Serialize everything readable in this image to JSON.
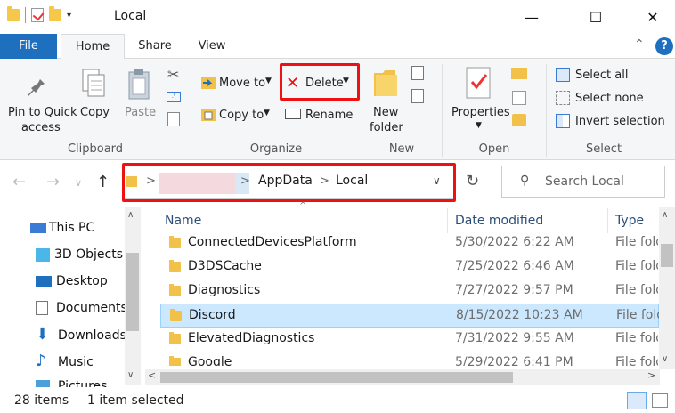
{
  "window": {
    "title": "Local",
    "minimize_glyph": "—",
    "maximize_glyph": "☐",
    "close_glyph": "✕"
  },
  "ribbon_tabs": {
    "file": "File",
    "home": "Home",
    "share": "Share",
    "view": "View"
  },
  "clipboard": {
    "pin": "Pin to Quick",
    "pin2": "access",
    "copy": "Copy",
    "paste": "Paste",
    "label": "Clipboard"
  },
  "organize": {
    "move_to": "Move to",
    "copy_to": "Copy to",
    "delete": "Delete",
    "rename": "Rename",
    "label": "Organize"
  },
  "new_group": {
    "new_folder": "New",
    "new_folder2": "folder",
    "label": "New"
  },
  "open_group": {
    "properties": "Properties",
    "label": "Open"
  },
  "select_group": {
    "select_all": "Select all",
    "select_none": "Select none",
    "invert": "Invert selection",
    "label": "Select"
  },
  "address": {
    "crumb_appdata": "AppData",
    "crumb_local": "Local",
    "sep": ">"
  },
  "search": {
    "placeholder": "Search Local"
  },
  "sidebar": {
    "items": [
      {
        "label": "This PC",
        "icon": "computer-icon"
      },
      {
        "label": "3D Objects",
        "icon": "cube-icon"
      },
      {
        "label": "Desktop",
        "icon": "desktop-icon"
      },
      {
        "label": "Documents",
        "icon": "document-icon"
      },
      {
        "label": "Downloads",
        "icon": "download-icon"
      },
      {
        "label": "Music",
        "icon": "music-icon"
      },
      {
        "label": "Pictures",
        "icon": "picture-icon"
      }
    ]
  },
  "columns": {
    "name": "Name",
    "date": "Date modified",
    "type": "Type"
  },
  "rows": [
    {
      "name": "ConnectedDevicesPlatform",
      "date": "5/30/2022 6:22 AM",
      "type": "File folder",
      "selected": false
    },
    {
      "name": "D3DSCache",
      "date": "7/25/2022 6:46 AM",
      "type": "File folder",
      "selected": false
    },
    {
      "name": "Diagnostics",
      "date": "7/27/2022 9:57 PM",
      "type": "File folder",
      "selected": false
    },
    {
      "name": "Discord",
      "date": "8/15/2022 10:23 AM",
      "type": "File folder",
      "selected": true
    },
    {
      "name": "ElevatedDiagnostics",
      "date": "7/31/2022 9:55 AM",
      "type": "File folder",
      "selected": false
    },
    {
      "name": "Google",
      "date": "5/29/2022 6:41 PM",
      "type": "File folder",
      "selected": false
    }
  ],
  "status": {
    "items": "28 items",
    "selected": "1 item selected"
  },
  "colors": {
    "accent": "#1f6fbf",
    "highlight": "#e11111",
    "selection": "#cce8ff",
    "folder": "#f2c14a"
  }
}
